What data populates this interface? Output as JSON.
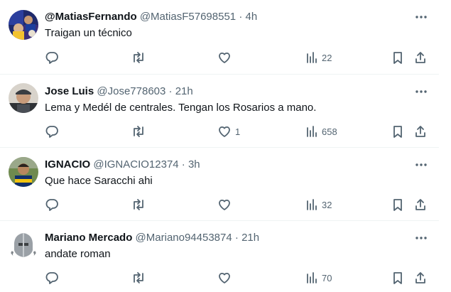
{
  "tweets": [
    {
      "name": "@MatiasFernando",
      "handle": "@MatiasF57698551",
      "dot": "·",
      "time": "4h",
      "text": "Traigan un técnico",
      "likes": "",
      "views": "22",
      "avatar_icon": "avatar-blue-collage"
    },
    {
      "name": "Jose Luis",
      "handle": "@Jose778603",
      "dot": "·",
      "time": "21h",
      "text": "Lema y Medél de centrales. Tengan los Rosarios a mano.",
      "likes": "1",
      "views": "658",
      "avatar_icon": "avatar-man-cap"
    },
    {
      "name": "IGNACIO",
      "handle": "@IGNACIO12374",
      "dot": "·",
      "time": "3h",
      "text": "Que hace Saracchi ahi",
      "likes": "",
      "views": "32",
      "avatar_icon": "avatar-player-stadium"
    },
    {
      "name": "Mariano Mercado",
      "handle": "@Mariano94453874",
      "dot": "·",
      "time": "21h",
      "text": "andate roman",
      "likes": "",
      "views": "70",
      "avatar_icon": "avatar-knight-helmet"
    }
  ],
  "colors": {
    "text": "#0f1419",
    "secondary": "#536471",
    "separator": "#eff3f4"
  }
}
